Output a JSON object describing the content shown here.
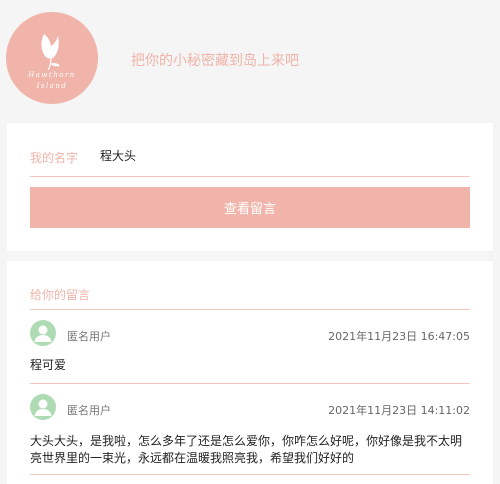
{
  "header": {
    "logo": {
      "icon": "tulip-icon",
      "line1": "Hawthorn",
      "line2": "Island",
      "color": "#f0b4aa"
    },
    "slogan": "把你的小秘密藏到岛上来吧"
  },
  "form": {
    "name_label": "我的名字",
    "name_value": "程大头",
    "button_label": "查看留言"
  },
  "messages": {
    "title": "给你的留言",
    "items": [
      {
        "user": "匿名用户",
        "time": "2021年11月23日 16:47:05",
        "content": "程可爱"
      },
      {
        "user": "匿名用户",
        "time": "2021年11月23日 14:11:02",
        "content": "大头大头，是我啦，怎么多年了还是怎么爱你，你咋怎么好呢，你好像是我不太明亮世界里的一束光，永远都在温暖我照亮我，希望我们好好的"
      }
    ]
  },
  "colors": {
    "accent": "#f0b4aa",
    "avatar": "#aedbb3",
    "background": "#f5f5f5"
  }
}
